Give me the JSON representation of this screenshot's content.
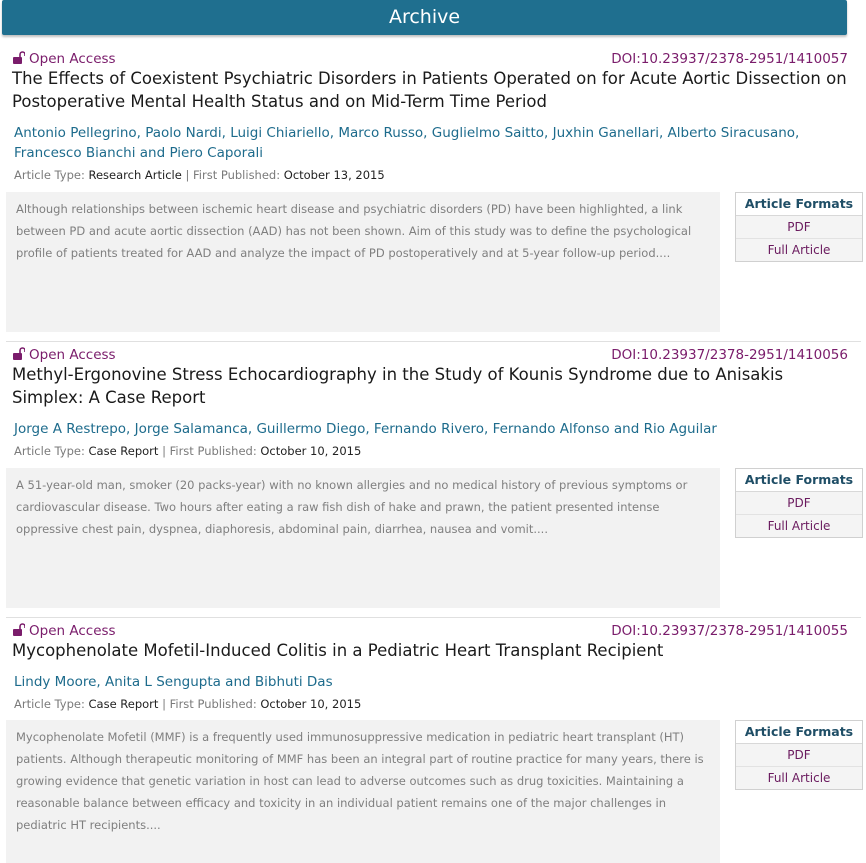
{
  "header": {
    "title": "Archive"
  },
  "articles": [
    {
      "access": "Open Access",
      "doi": "DOI:10.23937/2378-2951/1410057",
      "title": "The Effects of Coexistent Psychiatric Disorders in Patients Operated on for Acute Aortic Dissection on Postoperative Mental Health Status and on Mid-Term Time Period",
      "authors": "Antonio Pellegrino, Paolo Nardi, Luigi Chiariello, Marco Russo, Guglielmo Saitto, Juxhin Ganellari, Alberto Siracusano, Francesco Bianchi and Piero Caporali",
      "type_label": "Article Type:",
      "type_value": "Research Article",
      "sep": "|",
      "published_label": "First Published:",
      "published_value": "October 13, 2015",
      "abstract": "Although relationships between ischemic heart disease and psychiatric disorders (PD) have been highlighted, a link between PD and acute aortic dissection (AAD) has not been shown. Aim of this study was to define the psychological profile of patients treated for AAD and analyze the impact of PD postoperatively and at 5-year follow-up period....",
      "formats_label": "Article Formats",
      "pdf_label": "PDF",
      "full_label": "Full Article"
    },
    {
      "access": "Open Access",
      "doi": "DOI:10.23937/2378-2951/1410056",
      "title": "Methyl-Ergonovine Stress Echocardiography in the Study of Kounis Syndrome due to Anisakis Simplex: A Case Report",
      "authors": "Jorge A Restrepo, Jorge Salamanca, Guillermo Diego, Fernando Rivero, Fernando Alfonso and Rio Aguilar",
      "type_label": "Article Type:",
      "type_value": "Case Report",
      "sep": "|",
      "published_label": "First Published:",
      "published_value": "October 10, 2015",
      "abstract": "A 51-year-old man, smoker (20 packs-year) with no known allergies and no medical history of previous symptoms or cardiovascular disease. Two hours after eating a raw fish dish of hake and prawn, the patient presented intense oppressive chest pain, dyspnea, diaphoresis, abdominal pain, diarrhea, nausea and vomit....",
      "formats_label": "Article Formats",
      "pdf_label": "PDF",
      "full_label": "Full Article"
    },
    {
      "access": "Open Access",
      "doi": "DOI:10.23937/2378-2951/1410055",
      "title": "Mycophenolate Mofetil-Induced Colitis in a Pediatric Heart Transplant Recipient",
      "authors": "Lindy Moore, Anita L Sengupta and Bibhuti Das",
      "type_label": "Article Type:",
      "type_value": "Case Report",
      "sep": "|",
      "published_label": "First Published:",
      "published_value": "October 10, 2015",
      "abstract": "Mycophenolate Mofetil (MMF) is a frequently used immunosuppressive medication in pediatric heart transplant (HT) patients. Although therapeutic monitoring of MMF has been an integral part of routine practice for many years, there is growing evidence that genetic variation in host can lead to adverse outcomes such as drug toxicities. Maintaining a reasonable balance between efficacy and toxicity in an individual patient remains one of the major challenges in pediatric HT recipients....",
      "formats_label": "Article Formats",
      "pdf_label": "PDF",
      "full_label": "Full Article"
    }
  ],
  "icons": {
    "access": "unlocked-padlock-icon"
  },
  "colors": {
    "header_bg": "#1f6f8f",
    "access": "#7a1c6b",
    "authors": "#1d6b8c",
    "abstract_bg": "#f2f2f2"
  }
}
